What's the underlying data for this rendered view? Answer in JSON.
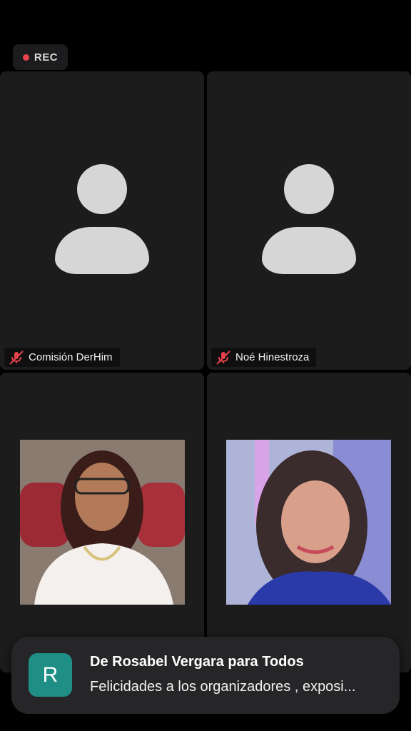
{
  "recording": {
    "label": "REC",
    "dot_color": "#e8424c"
  },
  "participants": [
    {
      "name": "Comisión DerHim",
      "muted": true,
      "video": false
    },
    {
      "name": "Noé Hinestroza",
      "muted": true,
      "video": false
    },
    {
      "name": "",
      "muted": true,
      "video": true
    },
    {
      "name": "",
      "muted": true,
      "video": true
    }
  ],
  "toast": {
    "avatar_letter": "R",
    "avatar_color": "#1f8e84",
    "title": "De Rosabel Vergara para Todos",
    "message": "Felicidades a los organizadores , exposi..."
  }
}
